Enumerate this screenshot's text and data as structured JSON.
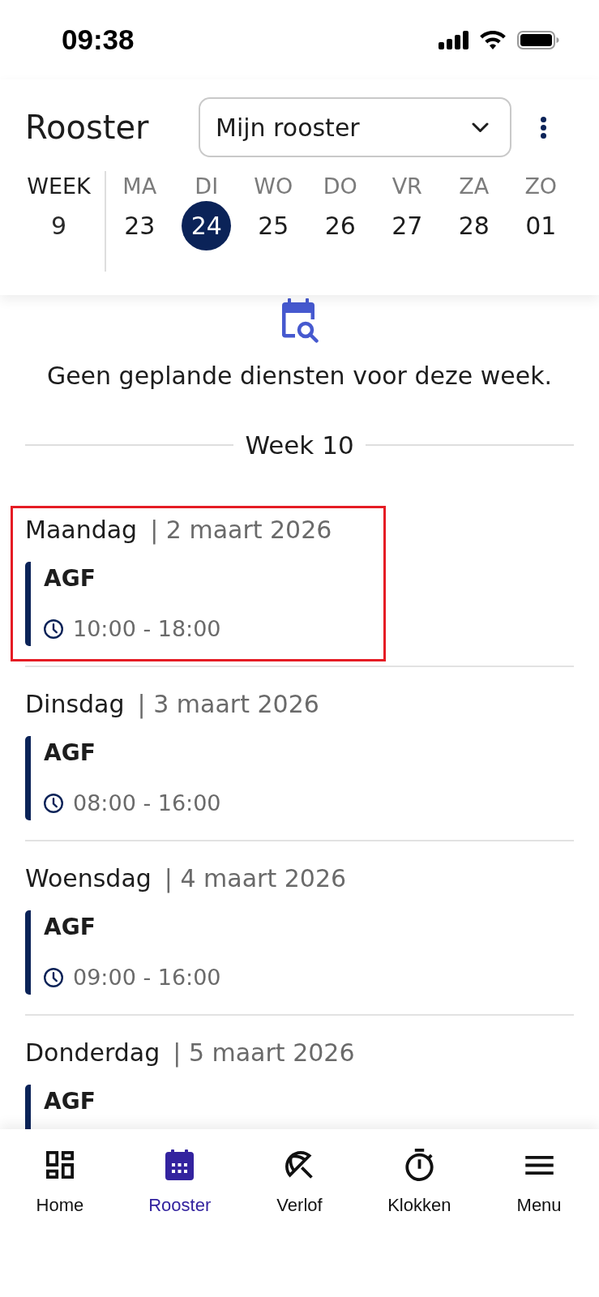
{
  "status_bar": {
    "time": "09:38"
  },
  "header": {
    "title": "Rooster",
    "schedule_select": {
      "value": "Mijn rooster"
    }
  },
  "week_strip": {
    "week_label": "WEEK",
    "week_number": "9",
    "days": [
      {
        "label": "MA",
        "date": "23",
        "selected": false
      },
      {
        "label": "DI",
        "date": "24",
        "selected": true
      },
      {
        "label": "WO",
        "date": "25",
        "selected": false
      },
      {
        "label": "DO",
        "date": "26",
        "selected": false
      },
      {
        "label": "VR",
        "date": "27",
        "selected": false
      },
      {
        "label": "ZA",
        "date": "28",
        "selected": false
      },
      {
        "label": "ZO",
        "date": "01",
        "selected": false
      }
    ]
  },
  "empty_state": {
    "message": "Geen geplande diensten voor deze week."
  },
  "week_divider": {
    "label": "Week 10"
  },
  "days": [
    {
      "day": "Maandag",
      "date": "| 2 maart 2026",
      "highlighted": true,
      "shifts": [
        {
          "title": "AGF",
          "time": "10:00 - 18:00"
        }
      ]
    },
    {
      "day": "Dinsdag",
      "date": "| 3 maart 2026",
      "highlighted": false,
      "shifts": [
        {
          "title": "AGF",
          "time": "08:00 - 16:00"
        }
      ]
    },
    {
      "day": "Woensdag",
      "date": "| 4 maart 2026",
      "highlighted": false,
      "shifts": [
        {
          "title": "AGF",
          "time": "09:00 - 16:00"
        }
      ]
    },
    {
      "day": "Donderdag",
      "date": "| 5 maart 2026",
      "highlighted": false,
      "shifts": [
        {
          "title": "AGF"
        }
      ]
    }
  ],
  "bottom_nav": [
    {
      "label": "Home",
      "selected": false
    },
    {
      "label": "Rooster",
      "selected": true
    },
    {
      "label": "Verlof",
      "selected": false
    },
    {
      "label": "Klokken",
      "selected": false
    },
    {
      "label": "Menu",
      "selected": false
    }
  ]
}
